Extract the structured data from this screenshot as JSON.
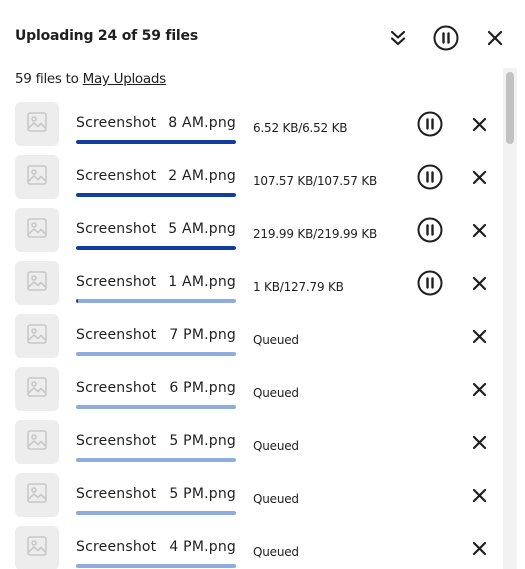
{
  "header": {
    "title": "Uploading 24 of 59 files",
    "collapse_icon": "double-chevron-down-icon",
    "pause_all_icon": "pause-circle-icon",
    "close_icon": "close-icon"
  },
  "summary": {
    "prefix": "59 files to ",
    "destination": "May Uploads"
  },
  "colors": {
    "progress_fill": "#123ea0",
    "progress_track": "#8eaddc",
    "thumbnail_bg": "#ededed"
  },
  "files": [
    {
      "name_prefix": "Screenshot",
      "name_suffix": "8 AM.png",
      "status": "6.52 KB/6.52 KB",
      "progress": 1.0,
      "pausable": true
    },
    {
      "name_prefix": "Screenshot",
      "name_suffix": "2 AM.png",
      "status": "107.57 KB/107.57 KB",
      "progress": 1.0,
      "pausable": true
    },
    {
      "name_prefix": "Screenshot",
      "name_suffix": "5 AM.png",
      "status": "219.99 KB/219.99 KB",
      "progress": 1.0,
      "pausable": true
    },
    {
      "name_prefix": "Screenshot",
      "name_suffix": "1 AM.png",
      "status": "1 KB/127.79 KB",
      "progress": 0.01,
      "pausable": true
    },
    {
      "name_prefix": "Screenshot",
      "name_suffix": "7 PM.png",
      "status": "Queued",
      "progress": 0.0,
      "pausable": false
    },
    {
      "name_prefix": "Screenshot",
      "name_suffix": "6 PM.png",
      "status": "Queued",
      "progress": 0.0,
      "pausable": false
    },
    {
      "name_prefix": "Screenshot",
      "name_suffix": "5 PM.png",
      "status": "Queued",
      "progress": 0.0,
      "pausable": false
    },
    {
      "name_prefix": "Screenshot",
      "name_suffix": "5 PM.png",
      "status": "Queued",
      "progress": 0.0,
      "pausable": false
    },
    {
      "name_prefix": "Screenshot",
      "name_suffix": "4 PM.png",
      "status": "Queued",
      "progress": 0.0,
      "pausable": false
    }
  ]
}
